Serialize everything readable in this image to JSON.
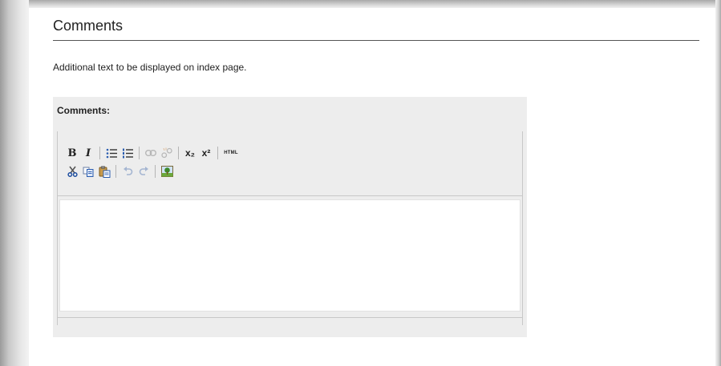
{
  "section": {
    "title": "Comments",
    "help_text": "Additional text to be displayed on index page."
  },
  "field": {
    "label": "Comments:",
    "value": ""
  },
  "toolbar": {
    "row1": [
      {
        "name": "bold-button",
        "glyph": "B"
      },
      {
        "name": "italic-button",
        "glyph": "I"
      },
      {
        "name": "bullet-list-button",
        "icon": "bullet-list-icon"
      },
      {
        "name": "numbered-list-button",
        "icon": "numbered-list-icon"
      },
      {
        "name": "link-button",
        "icon": "link-icon",
        "disabled": true
      },
      {
        "name": "unlink-button",
        "icon": "unlink-icon",
        "disabled": true
      },
      {
        "name": "subscript-button",
        "glyph": "x₂"
      },
      {
        "name": "superscript-button",
        "glyph": "x²"
      },
      {
        "name": "html-button",
        "glyph": "HTML"
      }
    ],
    "row2": [
      {
        "name": "cut-button",
        "icon": "scissors-icon"
      },
      {
        "name": "copy-button",
        "icon": "copy-icon"
      },
      {
        "name": "paste-button",
        "icon": "paste-icon"
      },
      {
        "name": "undo-button",
        "icon": "undo-icon",
        "disabled": true
      },
      {
        "name": "redo-button",
        "icon": "redo-icon",
        "disabled": true
      },
      {
        "name": "insert-image-button",
        "icon": "image-icon"
      }
    ]
  },
  "colors": {
    "field_background": "#ededed",
    "title_rule": "#555555"
  }
}
